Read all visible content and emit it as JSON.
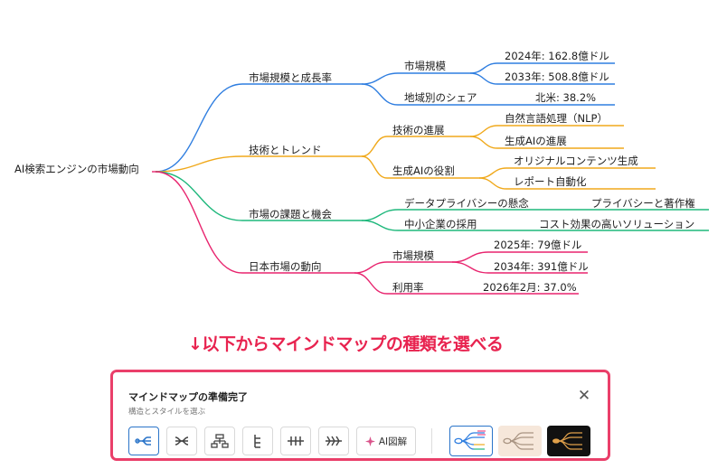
{
  "mindmap": {
    "root": "AI検索エンジンの市場動向",
    "branches": [
      {
        "label": "市場規模と成長率",
        "color": "#2f7ee0",
        "children": [
          {
            "label": "市場規模",
            "children": [
              "2024年: 162.8億ドル",
              "2033年: 508.8億ドル"
            ]
          },
          {
            "label": "地域別のシェア",
            "children": [
              "北米: 38.2%"
            ]
          }
        ]
      },
      {
        "label": "技術とトレンド",
        "color": "#f0a91c",
        "children": [
          {
            "label": "技術の進展",
            "children": [
              "自然言語処理（NLP）",
              "生成AIの進展"
            ]
          },
          {
            "label": "生成AIの役割",
            "children": [
              "オリジナルコンテンツ生成",
              "レポート自動化"
            ]
          }
        ]
      },
      {
        "label": "市場の課題と機会",
        "color": "#1fb87c",
        "children": [
          {
            "label": "データプライバシーの懸念",
            "children": [
              "プライバシーと著作権"
            ]
          },
          {
            "label": "中小企業の採用",
            "children": [
              "コスト効果の高いソリューション"
            ]
          }
        ]
      },
      {
        "label": "日本市場の動向",
        "color": "#e8246e",
        "children": [
          {
            "label": "市場規模",
            "children": [
              "2025年: 79億ドル",
              "2034年: 391億ドル"
            ]
          },
          {
            "label": "利用率",
            "children": [
              "2026年2月: 37.0%"
            ]
          }
        ]
      }
    ]
  },
  "annotation": "↓以下からマインドマップの種類を選べる",
  "panel": {
    "title": "マインドマップの準備完了",
    "subtitle": "構造とスタイルを選ぶ",
    "close_label": "✕",
    "layouts": [
      {
        "name": "layout-right-icon",
        "selected": true
      },
      {
        "name": "layout-both-sides-icon",
        "selected": false
      },
      {
        "name": "layout-org-chart-icon",
        "selected": false
      },
      {
        "name": "layout-tree-list-icon",
        "selected": false
      },
      {
        "name": "layout-timeline-icon",
        "selected": false
      },
      {
        "name": "layout-fishbone-icon",
        "selected": false
      }
    ],
    "ai_button_label": "AI図解",
    "styles": [
      {
        "name": "style-color-thumbnail",
        "background": "#ffffff",
        "selected": true
      },
      {
        "name": "style-beige-thumbnail",
        "background": "#f6e7da",
        "selected": false
      },
      {
        "name": "style-dark-thumbnail",
        "background": "#111111",
        "selected": false
      }
    ],
    "accent": "#2a74c9",
    "highlight_border": "#ea3f6a"
  }
}
